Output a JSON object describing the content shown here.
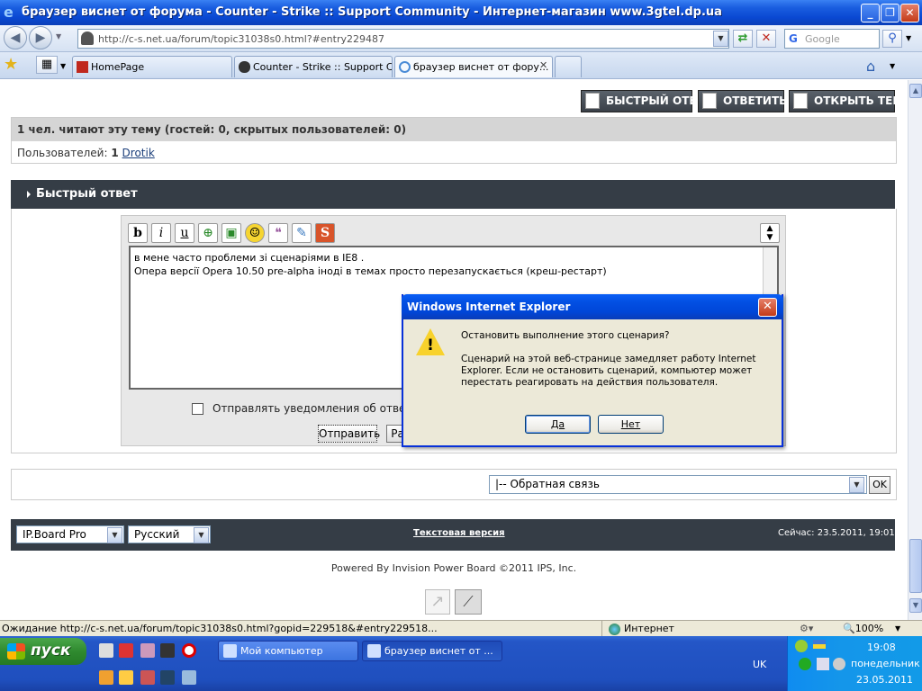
{
  "window": {
    "title": "браузер виснет от форума - Counter - Strike :: Support Community - Интернет-магазин www.3gtel.dp.ua"
  },
  "address_bar": {
    "url": "http://c-s.net.ua/forum/topic31038s0.html?#entry229487",
    "search_placeholder": "Google"
  },
  "tabs": [
    {
      "label": "HomePage",
      "active": false
    },
    {
      "label": "Counter - Strike :: Support C...",
      "active": false
    },
    {
      "label": "браузер виснет от фору...",
      "active": true
    }
  ],
  "forum": {
    "buttons": {
      "fast_reply": "БЫСТРЫЙ ОТВЕТ",
      "reply": "ОТВЕТИТЬ",
      "new_topic": "ОТКРЫТЬ ТЕМУ"
    },
    "readers_header": "1 чел. читают эту тему (гостей: 0, скрытых пользователей: 0)",
    "users_prefix": "Пользователей:",
    "users_count": "1",
    "user_name": "Drotik",
    "quick_reply_title": "Быстрый ответ",
    "editor_lines": [
      "в мене часто проблеми зі сценаріями в IE8 .",
      "Опера версії Opera 10.50 pre-alpha іноді в темах просто перезапускається (креш-рестарт)"
    ],
    "notify_label": "Отправлять уведомления об ответах",
    "submit_label": "Отправить",
    "extra_label": "Ра",
    "jump_select": "|-- Обратная связь",
    "jump_ok": "OK",
    "skin_select": "IP.Board Pro",
    "lang_select": "Русский",
    "text_version": "Текстовая версия",
    "now": "Сейчас: 23.5.2011, 19:01",
    "powered": "Powered By Invision Power Board  ©2011  IPS, Inc."
  },
  "status_bar": {
    "text": "Ожидание http://c-s.net.ua/forum/topic31038s0.html?gopid=229518&#entry229518...",
    "zone": "Интернет",
    "zoom": "100%"
  },
  "taskbar": {
    "start": "пуск",
    "tasks": [
      {
        "label": "Мой компьютер",
        "active": false
      },
      {
        "label": "браузер виснет от ...",
        "active": true
      }
    ],
    "lang": "UK",
    "time": "19:08",
    "day": "понедельник",
    "date": "23.05.2011"
  },
  "dialog": {
    "title": "Windows Internet Explorer",
    "question": "Остановить выполнение этого сценария?",
    "body": "Сценарий на этой веб-странице замедляет работу Internet Explorer. Если не остановить сценарий, компьютер может перестать реагировать на действия пользователя.",
    "yes": "Да",
    "no": "Нет"
  },
  "icons": [
    "ie-logo-icon",
    "back-icon",
    "forward-icon",
    "refresh-icon",
    "stop-icon",
    "search-icon",
    "favorites-star-icon",
    "home-icon",
    "warning-icon",
    "windows-flag-icon",
    "internet-globe-icon",
    "zoom-icon"
  ]
}
